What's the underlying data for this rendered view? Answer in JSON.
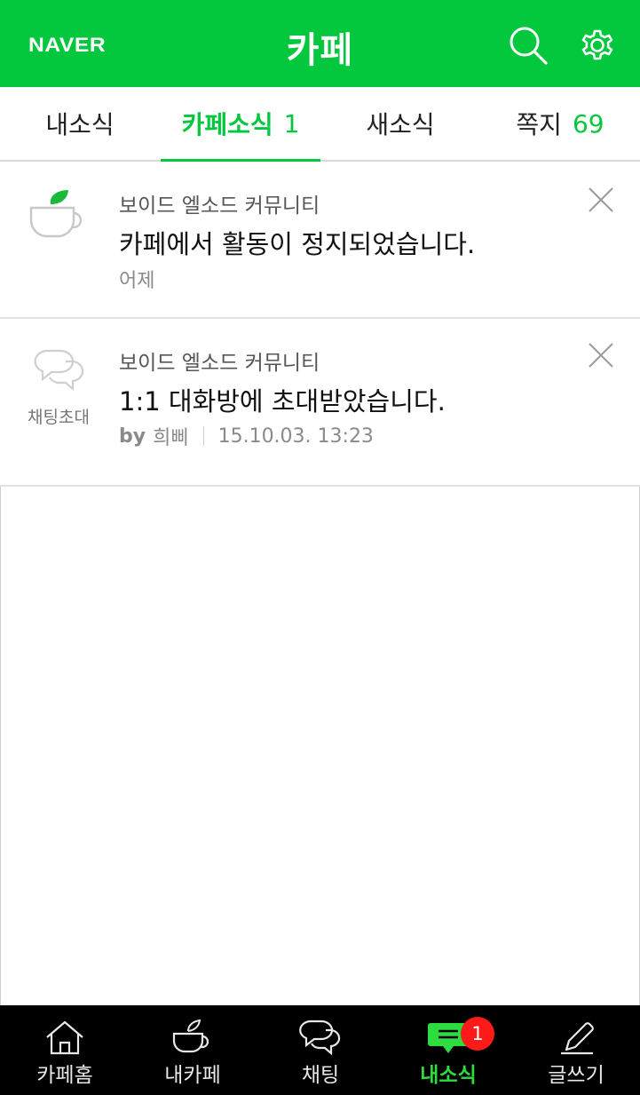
{
  "header": {
    "logo": "NAVER",
    "title": "카페",
    "brand_color": "#03c73c",
    "search_icon": "search-icon",
    "settings_icon": "gear-icon"
  },
  "tabs": [
    {
      "label": "내소식",
      "count": "",
      "active": false
    },
    {
      "label": "카페소식",
      "count": "1",
      "active": true
    },
    {
      "label": "새소식",
      "count": "",
      "active": false
    },
    {
      "label": "쪽지",
      "count": "69",
      "active": false
    }
  ],
  "notifications": [
    {
      "icon": "teacup-leaf-icon",
      "icon_caption": "",
      "cafe_name": "보이드 엘소드 커뮤니티",
      "message": "카페에서 활동이 정지되었습니다.",
      "time": "어제",
      "author_prefix": "",
      "author": ""
    },
    {
      "icon": "chat-bubbles-icon",
      "icon_caption": "채팅초대",
      "cafe_name": "보이드 엘소드 커뮤니티",
      "message": "1:1 대화방에 초대받았습니다.",
      "time": "15.10.03. 13:23",
      "author_prefix": "by",
      "author": "희삐"
    }
  ],
  "bottom_nav": [
    {
      "label": "카페홈",
      "icon": "home-icon",
      "active": false
    },
    {
      "label": "내카페",
      "icon": "teacup-icon",
      "active": false
    },
    {
      "label": "채팅",
      "icon": "chat-icon",
      "active": false
    },
    {
      "label": "내소식",
      "icon": "message-icon",
      "active": true,
      "badge": "1"
    },
    {
      "label": "글쓰기",
      "icon": "pencil-icon",
      "active": false
    }
  ],
  "colors": {
    "accent": "#03c73c",
    "badge": "#ff1a1a",
    "nav_background": "#000000"
  }
}
